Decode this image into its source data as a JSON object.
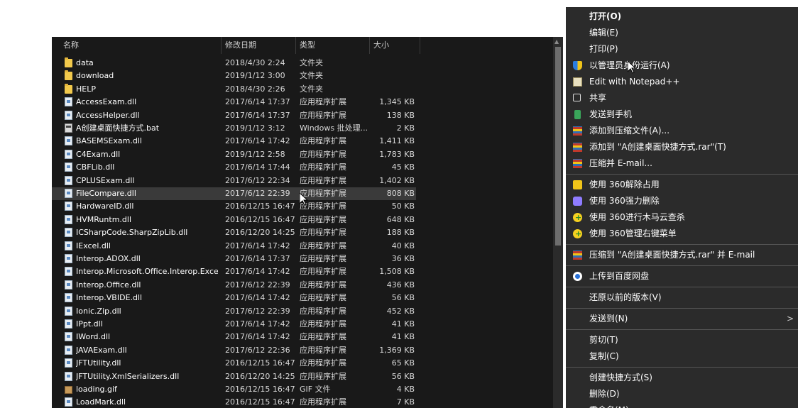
{
  "explorer": {
    "columns": {
      "name": "名称",
      "date": "修改日期",
      "type": "类型",
      "size": "大小"
    },
    "sort_arrow": "^",
    "files": [
      {
        "icon": "folder-icon",
        "name": "data",
        "date": "2018/4/30 2:24",
        "type": "文件夹",
        "size": ""
      },
      {
        "icon": "folder-icon",
        "name": "download",
        "date": "2019/1/12 3:00",
        "type": "文件夹",
        "size": ""
      },
      {
        "icon": "folder-icon",
        "name": "HELP",
        "date": "2018/4/30 2:26",
        "type": "文件夹",
        "size": ""
      },
      {
        "icon": "dll-file-icon",
        "name": "AccessExam.dll",
        "date": "2017/6/14 17:37",
        "type": "应用程序扩展",
        "size": "1,345 KB"
      },
      {
        "icon": "dll-file-icon",
        "name": "AccessHelper.dll",
        "date": "2017/6/14 17:37",
        "type": "应用程序扩展",
        "size": "138 KB"
      },
      {
        "icon": "bat-file-icon",
        "name": "A创建桌面快捷方式.bat",
        "date": "2019/1/12 3:12",
        "type": "Windows 批处理...",
        "size": "2 KB"
      },
      {
        "icon": "dll-file-icon",
        "name": "BASEMSExam.dll",
        "date": "2017/6/14 17:42",
        "type": "应用程序扩展",
        "size": "1,411 KB"
      },
      {
        "icon": "dll-file-icon",
        "name": "C4Exam.dll",
        "date": "2019/1/12 2:58",
        "type": "应用程序扩展",
        "size": "1,783 KB"
      },
      {
        "icon": "dll-file-icon",
        "name": "CBFLib.dll",
        "date": "2017/6/14 17:44",
        "type": "应用程序扩展",
        "size": "45 KB"
      },
      {
        "icon": "dll-file-icon",
        "name": "CPLUSExam.dll",
        "date": "2017/6/12 22:34",
        "type": "应用程序扩展",
        "size": "1,402 KB"
      },
      {
        "icon": "dll-file-icon",
        "name": "FileCompare.dll",
        "date": "2017/6/12 22:39",
        "type": "应用程序扩展",
        "size": "808 KB",
        "selected": true
      },
      {
        "icon": "dll-file-icon",
        "name": "HardwareID.dll",
        "date": "2016/12/15 16:47",
        "type": "应用程序扩展",
        "size": "50 KB"
      },
      {
        "icon": "dll-file-icon",
        "name": "HVMRuntm.dll",
        "date": "2016/12/15 16:47",
        "type": "应用程序扩展",
        "size": "648 KB"
      },
      {
        "icon": "dll-file-icon",
        "name": "ICSharpCode.SharpZipLib.dll",
        "date": "2016/12/20 14:25",
        "type": "应用程序扩展",
        "size": "188 KB"
      },
      {
        "icon": "dll-file-icon",
        "name": "IExcel.dll",
        "date": "2017/6/14 17:42",
        "type": "应用程序扩展",
        "size": "40 KB"
      },
      {
        "icon": "dll-file-icon",
        "name": "Interop.ADOX.dll",
        "date": "2017/6/14 17:37",
        "type": "应用程序扩展",
        "size": "36 KB"
      },
      {
        "icon": "dll-file-icon",
        "name": "Interop.Microsoft.Office.Interop.Excel...",
        "date": "2017/6/14 17:42",
        "type": "应用程序扩展",
        "size": "1,508 KB"
      },
      {
        "icon": "dll-file-icon",
        "name": "Interop.Office.dll",
        "date": "2017/6/12 22:39",
        "type": "应用程序扩展",
        "size": "436 KB"
      },
      {
        "icon": "dll-file-icon",
        "name": "Interop.VBIDE.dll",
        "date": "2017/6/14 17:42",
        "type": "应用程序扩展",
        "size": "56 KB"
      },
      {
        "icon": "dll-file-icon",
        "name": "Ionic.Zip.dll",
        "date": "2017/6/12 22:39",
        "type": "应用程序扩展",
        "size": "452 KB"
      },
      {
        "icon": "dll-file-icon",
        "name": "IPpt.dll",
        "date": "2017/6/14 17:42",
        "type": "应用程序扩展",
        "size": "41 KB"
      },
      {
        "icon": "dll-file-icon",
        "name": "IWord.dll",
        "date": "2017/6/14 17:42",
        "type": "应用程序扩展",
        "size": "41 KB"
      },
      {
        "icon": "dll-file-icon",
        "name": "JAVAExam.dll",
        "date": "2017/6/12 22:36",
        "type": "应用程序扩展",
        "size": "1,369 KB"
      },
      {
        "icon": "dll-file-icon",
        "name": "JFTUtility.dll",
        "date": "2016/12/15 16:47",
        "type": "应用程序扩展",
        "size": "65 KB"
      },
      {
        "icon": "dll-file-icon",
        "name": "JFTUtility.XmlSerializers.dll",
        "date": "2016/12/20 14:25",
        "type": "应用程序扩展",
        "size": "56 KB"
      },
      {
        "icon": "gif-file-icon",
        "name": "loading.gif",
        "date": "2016/12/15 16:47",
        "type": "GIF 文件",
        "size": "4 KB"
      },
      {
        "icon": "dll-file-icon",
        "name": "LoadMark.dll",
        "date": "2016/12/15 16:47",
        "type": "应用程序扩展",
        "size": "7 KB"
      }
    ]
  },
  "context_menu": {
    "items": [
      {
        "label": "打开(O)",
        "bold": true,
        "icon": ""
      },
      {
        "label": "编辑(E)",
        "icon": ""
      },
      {
        "label": "打印(P)",
        "icon": ""
      },
      {
        "label": "以管理员身份运行(A)",
        "icon": "uac-shield-icon"
      },
      {
        "label": "Edit with Notepad++",
        "icon": "notepad-plus-plus-icon"
      },
      {
        "label": "共享",
        "icon": "share-icon"
      },
      {
        "label": "发送到手机",
        "icon": "phone-icon"
      },
      {
        "label": "添加到压缩文件(A)...",
        "icon": "winrar-icon"
      },
      {
        "label": "添加到 \"A创建桌面快捷方式.rar\"(T)",
        "icon": "winrar-icon"
      },
      {
        "label": "压缩并 E-mail...",
        "icon": "winrar-icon"
      },
      {
        "separator": true
      },
      {
        "label": "使用 360解除占用",
        "icon": "360-unlock-icon"
      },
      {
        "label": "使用 360强力删除",
        "icon": "360-delete-icon"
      },
      {
        "label": "使用 360进行木马云查杀",
        "icon": "360-icon"
      },
      {
        "label": "使用 360管理右键菜单",
        "icon": "360-icon"
      },
      {
        "separator": true
      },
      {
        "label": "压缩到 \"A创建桌面快捷方式.rar\" 并 E-mail",
        "icon": "winrar-icon"
      },
      {
        "separator": true
      },
      {
        "label": "上传到百度网盘",
        "icon": "baidu-netdisk-icon"
      },
      {
        "separator": true
      },
      {
        "label": "还原以前的版本(V)",
        "icon": ""
      },
      {
        "separator": true
      },
      {
        "label": "发送到(N)",
        "icon": "",
        "submenu": true
      },
      {
        "separator": true
      },
      {
        "label": "剪切(T)",
        "icon": ""
      },
      {
        "label": "复制(C)",
        "icon": ""
      },
      {
        "separator": true
      },
      {
        "label": "创建快捷方式(S)",
        "icon": ""
      },
      {
        "label": "删除(D)",
        "icon": ""
      },
      {
        "label": "重命名(M)",
        "icon": ""
      }
    ],
    "submenu_arrow": ">"
  }
}
